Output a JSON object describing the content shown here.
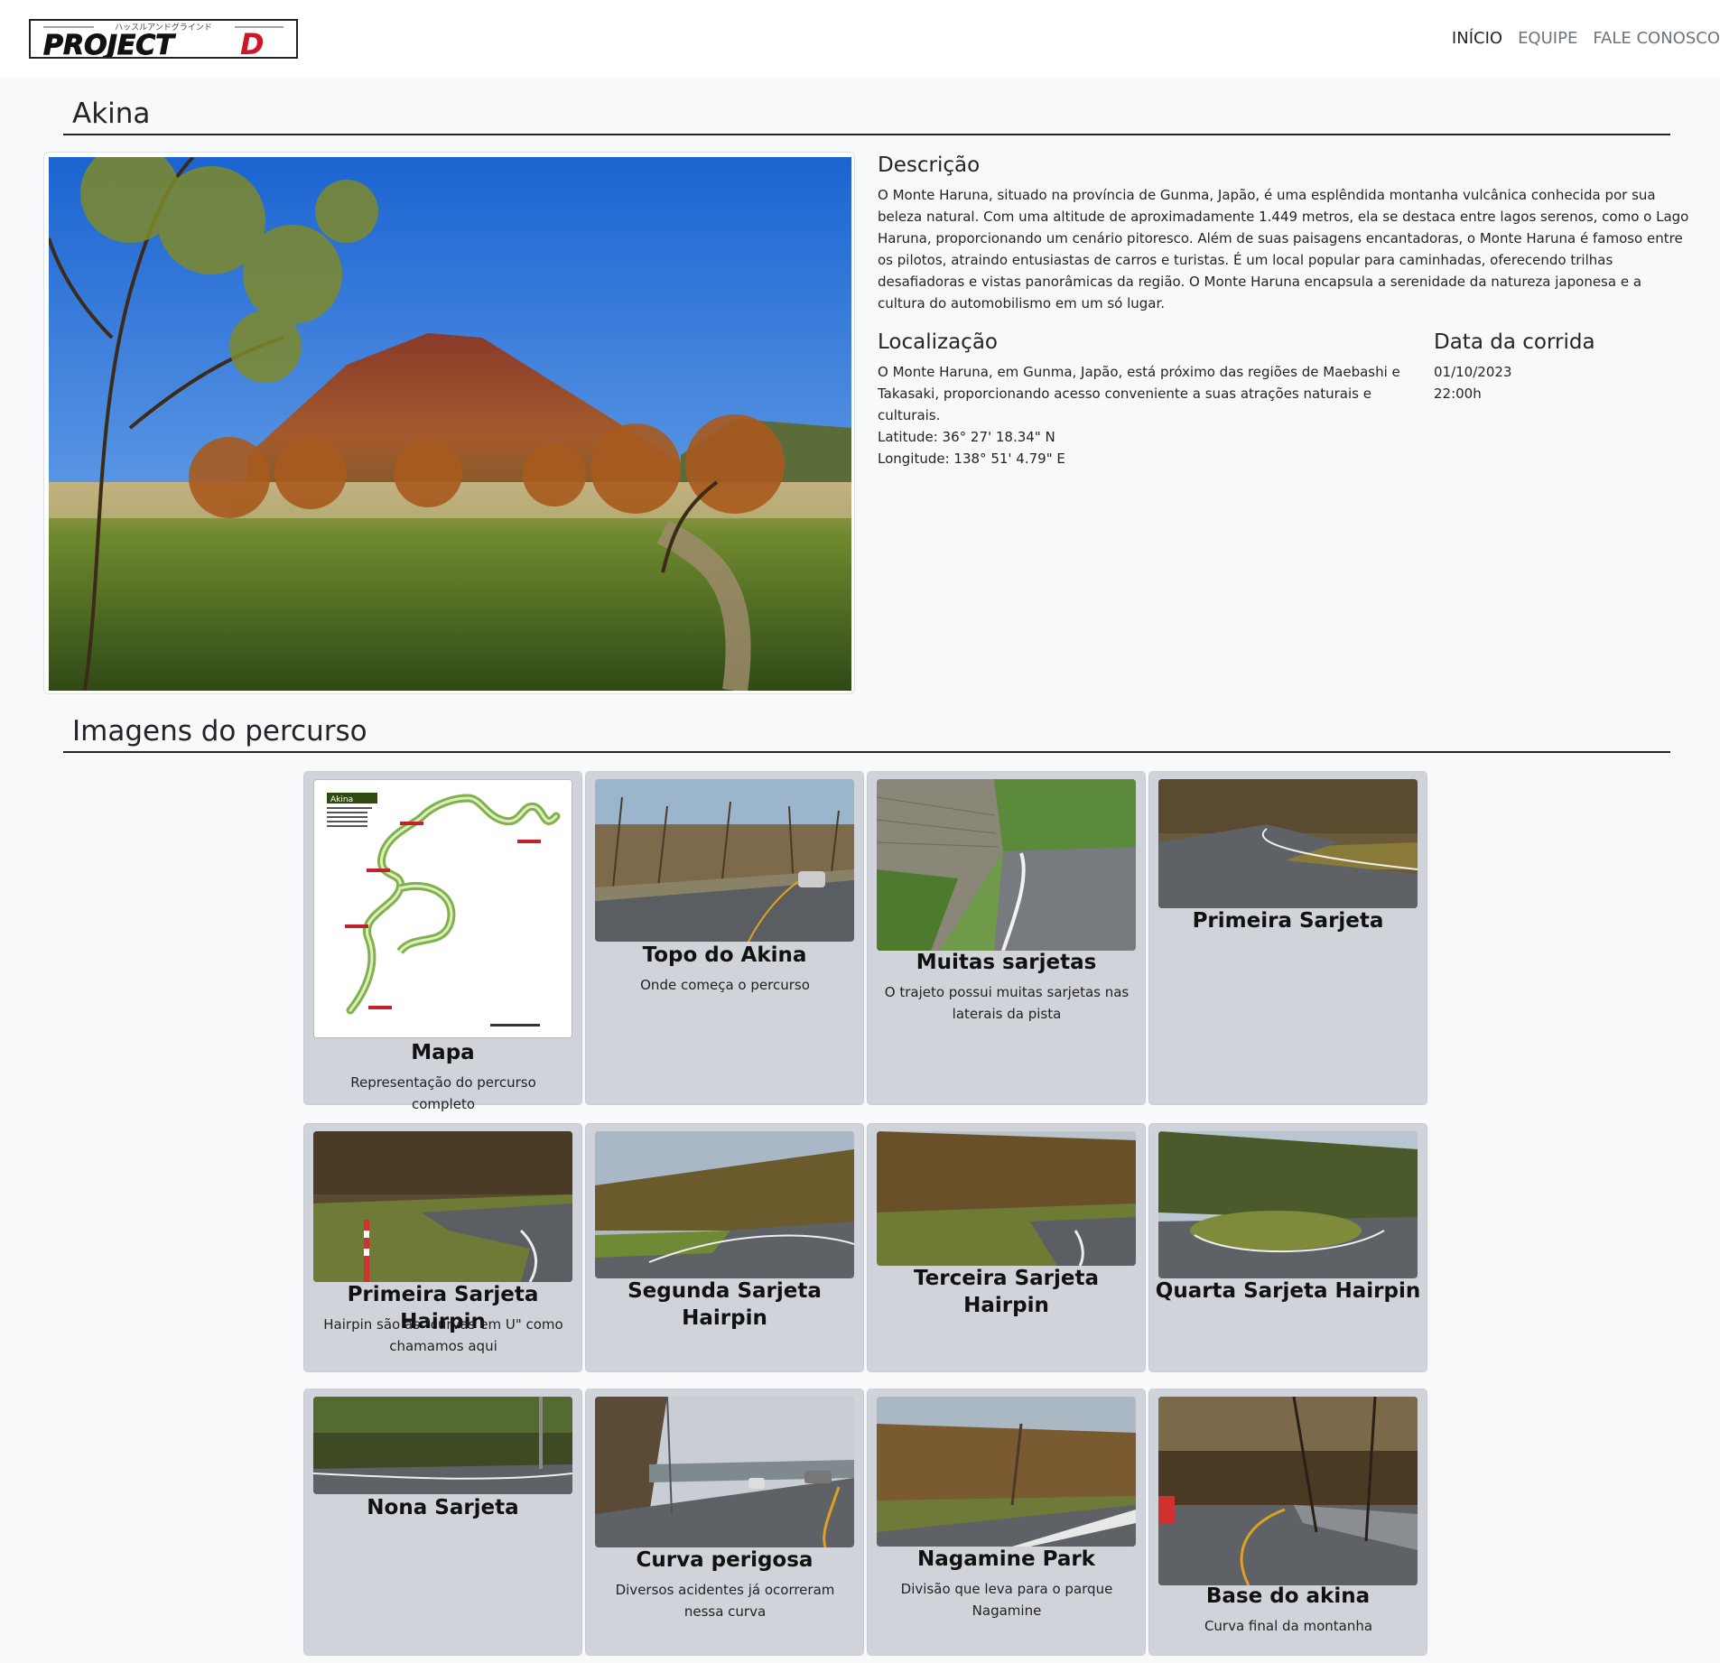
{
  "nav": {
    "logo_text": "PROJECT D",
    "logo_kana": "ハッスルアンドグラインド",
    "links": [
      "INÍCIO",
      "EQUIPE",
      "FALE CONOSCO"
    ]
  },
  "page": {
    "title": "Akina",
    "hero_alt": "Monte Haruna"
  },
  "description": {
    "heading": "Descrição",
    "text": "O Monte Haruna, situado na província de Gunma, Japão, é uma esplêndida montanha vulcânica conhecida por sua beleza natural. Com uma altitude de aproximadamente 1.449 metros, ela se destaca entre lagos serenos, como o Lago Haruna, proporcionando um cenário pitoresco. Além de suas paisagens encantadoras, o Monte Haruna é famoso entre os pilotos, atraindo entusiastas de carros e turistas. É um local popular para caminhadas, oferecendo trilhas desafiadoras e vistas panorâmicas da região. O Monte Haruna encapsula a serenidade da natureza japonesa e a cultura do automobilismo em um só lugar."
  },
  "location": {
    "heading": "Localização",
    "text": "O Monte Haruna, em Gunma, Japão, está próximo das regiões de Maebashi e Takasaki, proporcionando acesso conveniente a suas atrações naturais e culturais.",
    "latitude": "Latitude: 36° 27' 18.34\" N",
    "longitude": "Longitude: 138° 51' 4.79\" E"
  },
  "race_date": {
    "heading": "Data da corrida",
    "date": "01/10/2023",
    "time": "22:00h"
  },
  "gallery": {
    "heading": "Imagens do percurso",
    "map_label": "Akina",
    "cards": [
      {
        "title": "Mapa",
        "subtitle": "Representação do percurso completo"
      },
      {
        "title": "Topo do Akina",
        "subtitle": "Onde começa o percurso"
      },
      {
        "title": "Muitas sarjetas",
        "subtitle": "O trajeto possui muitas sarjetas nas laterais da pista"
      },
      {
        "title": "Primeira Sarjeta",
        "subtitle": ""
      },
      {
        "title": "Primeira Sarjeta Hairpin",
        "subtitle": "Hairpin são as \"curvas em U\" como chamamos aqui"
      },
      {
        "title": "Segunda Sarjeta Hairpin",
        "subtitle": ""
      },
      {
        "title": "Terceira Sarjeta Hairpin",
        "subtitle": ""
      },
      {
        "title": "Quarta Sarjeta Hairpin",
        "subtitle": ""
      },
      {
        "title": "Nona Sarjeta",
        "subtitle": ""
      },
      {
        "title": "Curva perigosa",
        "subtitle": "Diversos acidentes já ocorreram nessa curva"
      },
      {
        "title": "Nagamine Park",
        "subtitle": "Divisão que leva para o parque Nagamine"
      },
      {
        "title": "Base do akina",
        "subtitle": "Curva final da montanha"
      }
    ]
  }
}
